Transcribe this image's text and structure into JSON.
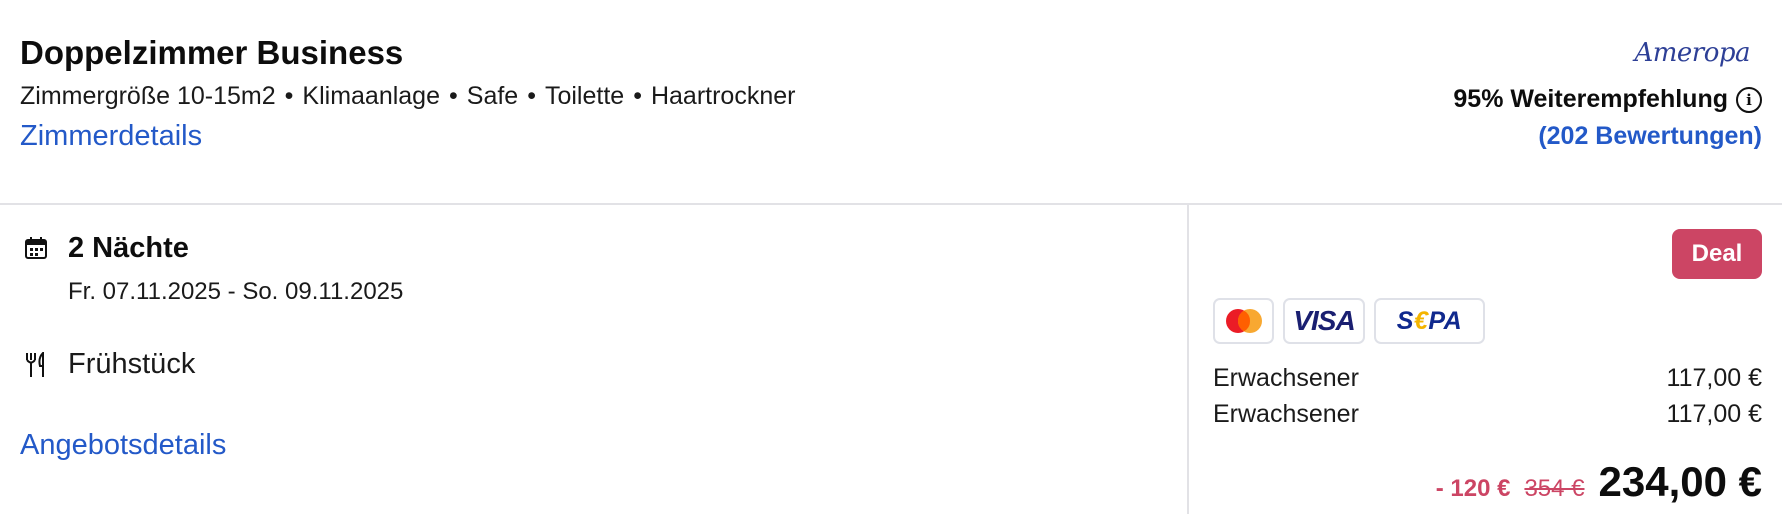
{
  "room": {
    "title": "Doppelzimmer Business",
    "features": [
      "Zimmergröße 10-15m2",
      "Klimaanlage",
      "Safe",
      "Toilette",
      "Haartrockner"
    ],
    "details_link": "Zimmerdetails"
  },
  "provider": {
    "brand": "Ameropa",
    "recommendation": "95% Weiterempfehlung",
    "reviews_link": "(202 Bewertungen)"
  },
  "stay": {
    "nights": "2 Nächte",
    "dates": "Fr. 07.11.2025 - So. 09.11.2025",
    "board": "Frühstück",
    "offer_details_link": "Angebotsdetails"
  },
  "pricing": {
    "badge": "Deal",
    "payment_methods": [
      "mastercard-icon",
      "visa-icon",
      "sepa-icon"
    ],
    "visa_text": "VISA",
    "sepa_text": {
      "a": "S",
      "b": "€",
      "c": "PA"
    },
    "rows": [
      {
        "label": "Erwachsener",
        "price": "117,00 €"
      },
      {
        "label": "Erwachsener",
        "price": "117,00 €"
      }
    ],
    "discount": "- 120 €",
    "old_price": "354 €",
    "total": "234,00 €"
  },
  "colors": {
    "link": "#2359c8",
    "deal": "#cc4564",
    "divider": "#e2e2e6"
  }
}
